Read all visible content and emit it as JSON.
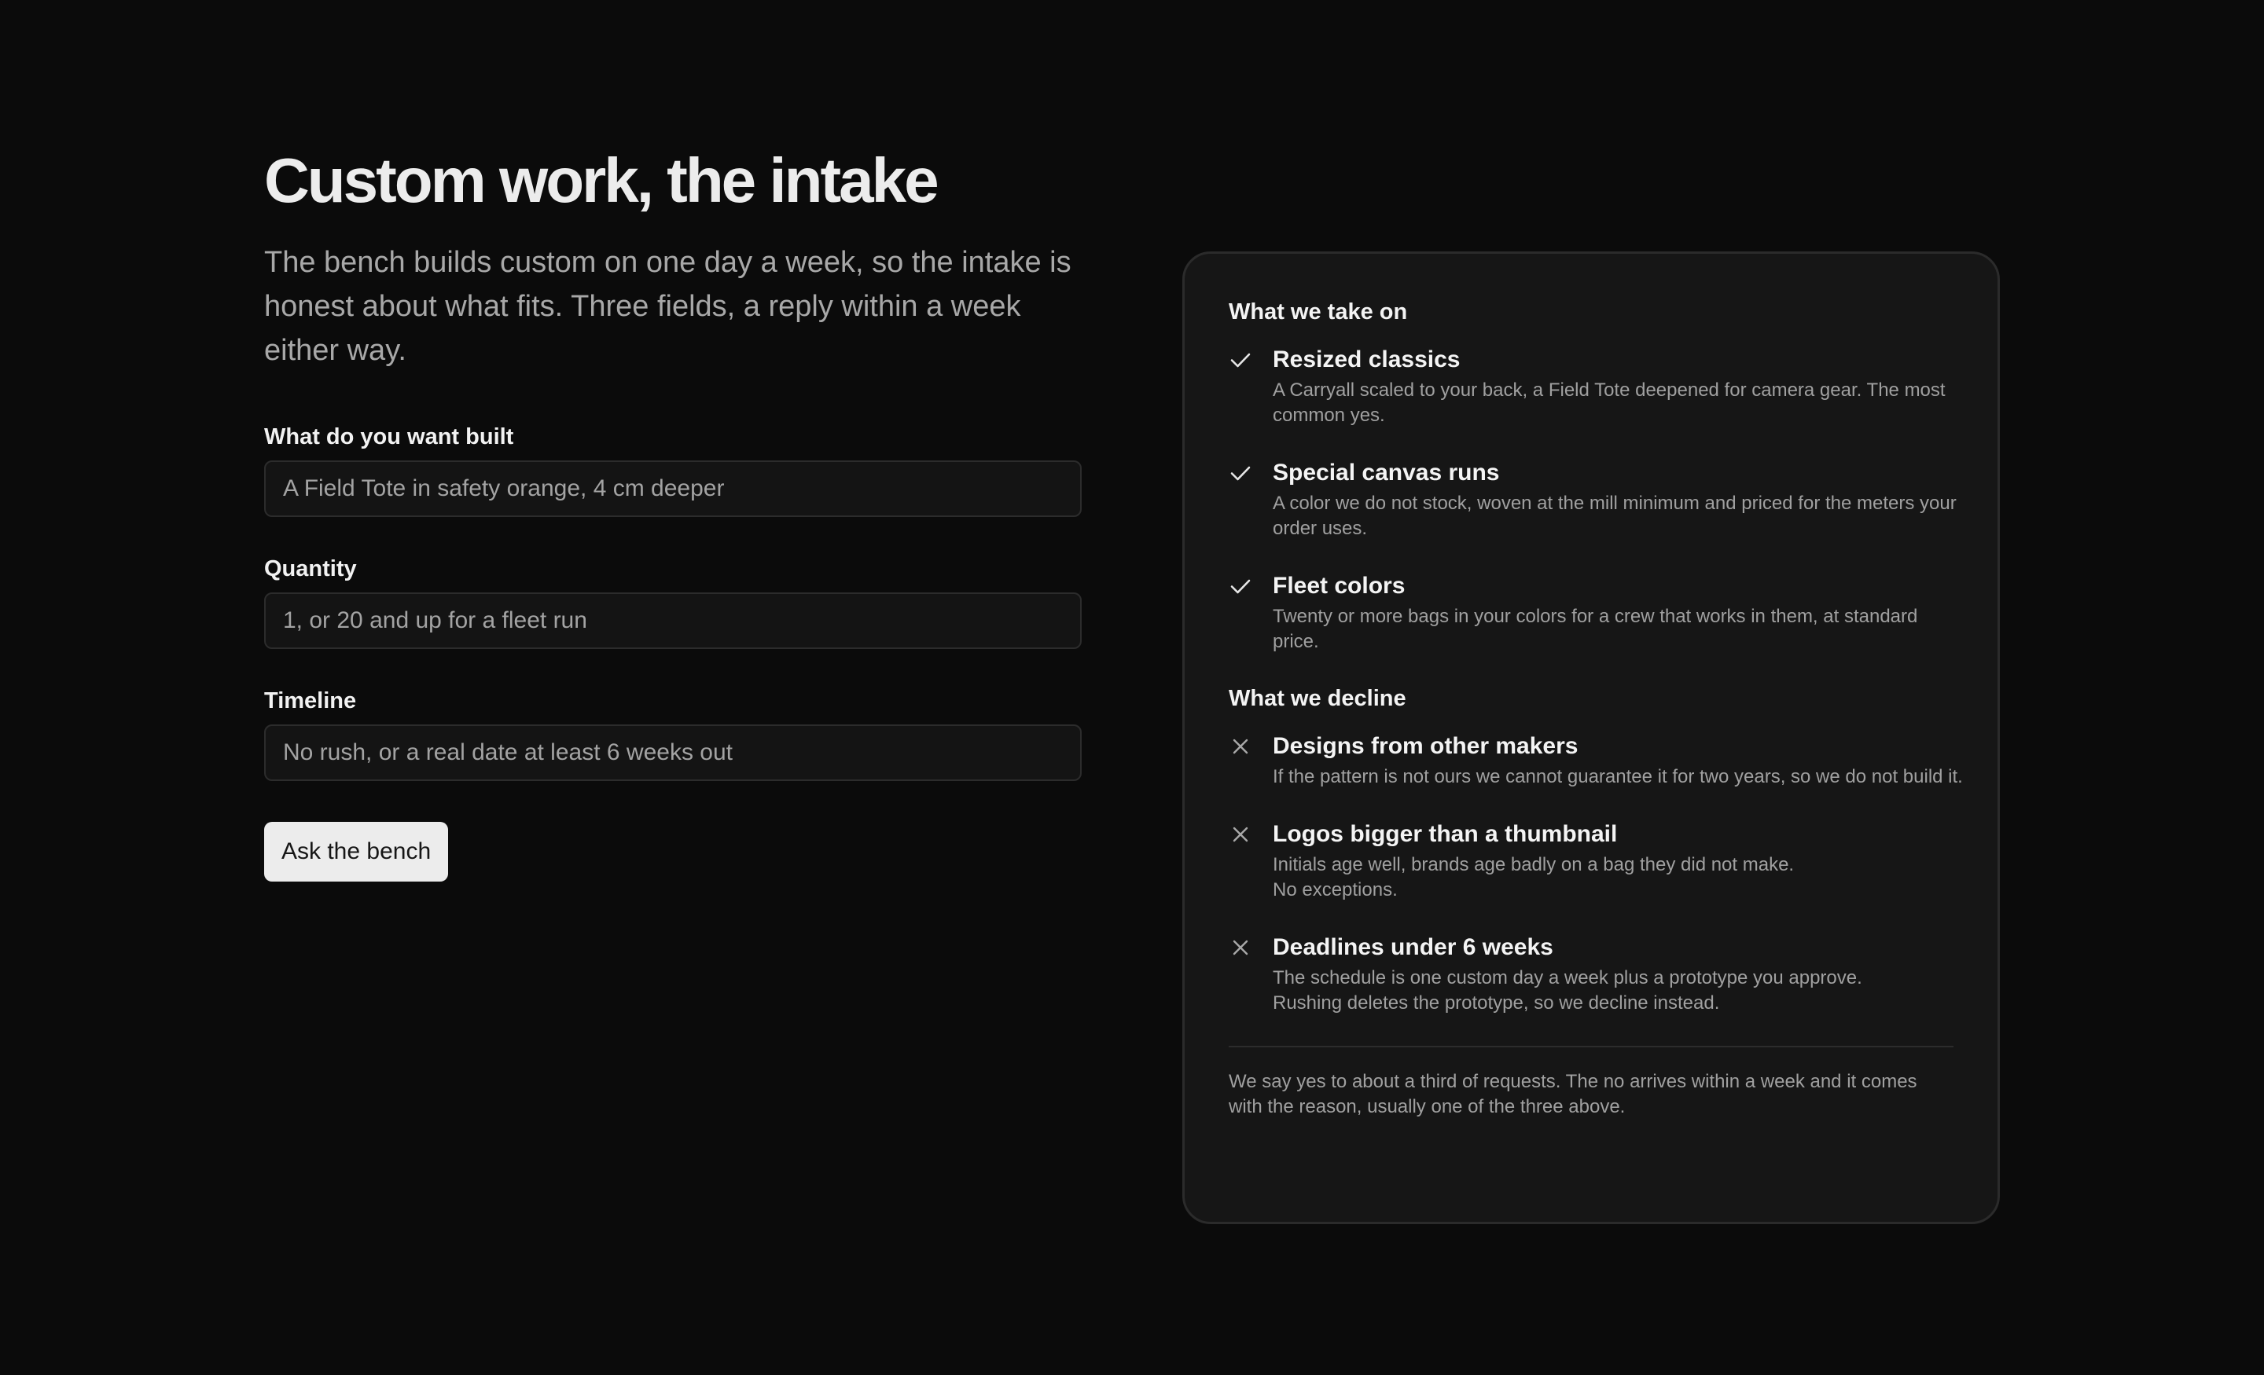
{
  "intake": {
    "title": "Custom work, the intake",
    "intro": "The bench builds custom on one day a week, so the intake is honest about what fits. Three fields, a reply within a week either way.",
    "fields": [
      {
        "label": "What do you want built",
        "placeholder": "A Field Tote in safety orange, 4 cm deeper",
        "value": ""
      },
      {
        "label": "Quantity",
        "placeholder": "1, or 20 and up for a fleet run",
        "value": ""
      },
      {
        "label": "Timeline",
        "placeholder": "No rush, or a real date at least 6 weeks out",
        "value": ""
      }
    ],
    "submit_label": "Ask the bench"
  },
  "policy": {
    "accept_heading": "What we take on",
    "accept_items": [
      {
        "icon": "check-icon",
        "title": "Resized classics",
        "body": "A Carryall scaled to your back, a Field Tote deepened for camera gear. The most common yes."
      },
      {
        "icon": "check-icon",
        "title": "Special canvas runs",
        "body": "A color we do not stock, woven at the mill minimum and priced for the meters your order uses."
      },
      {
        "icon": "check-icon",
        "title": "Fleet colors",
        "body": "Twenty or more bags in your colors for a crew that works in them, at standard price."
      }
    ],
    "decline_heading": "What we decline",
    "decline_items": [
      {
        "icon": "x-icon",
        "title": "Designs from other makers",
        "body": "If the pattern is not ours we cannot guarantee it for two years, so we do not build it."
      },
      {
        "icon": "x-icon",
        "title": "Logos bigger than a thumbnail",
        "body": "Initials age well, brands age badly on a bag they did not make.\nNo exceptions."
      },
      {
        "icon": "x-icon",
        "title": "Deadlines under 6 weeks",
        "body": "The schedule is one custom day a week plus a prototype you approve.\nRushing deletes the prototype, so we decline instead."
      }
    ],
    "footnote": "We say yes to about a third of requests. The no arrives within a week and it comes with the reason, usually one of the three above."
  },
  "colors": {
    "background": "#0b0b0b",
    "card": "#161616",
    "button": "#ececec",
    "muted_text": "#a0a0a0"
  }
}
